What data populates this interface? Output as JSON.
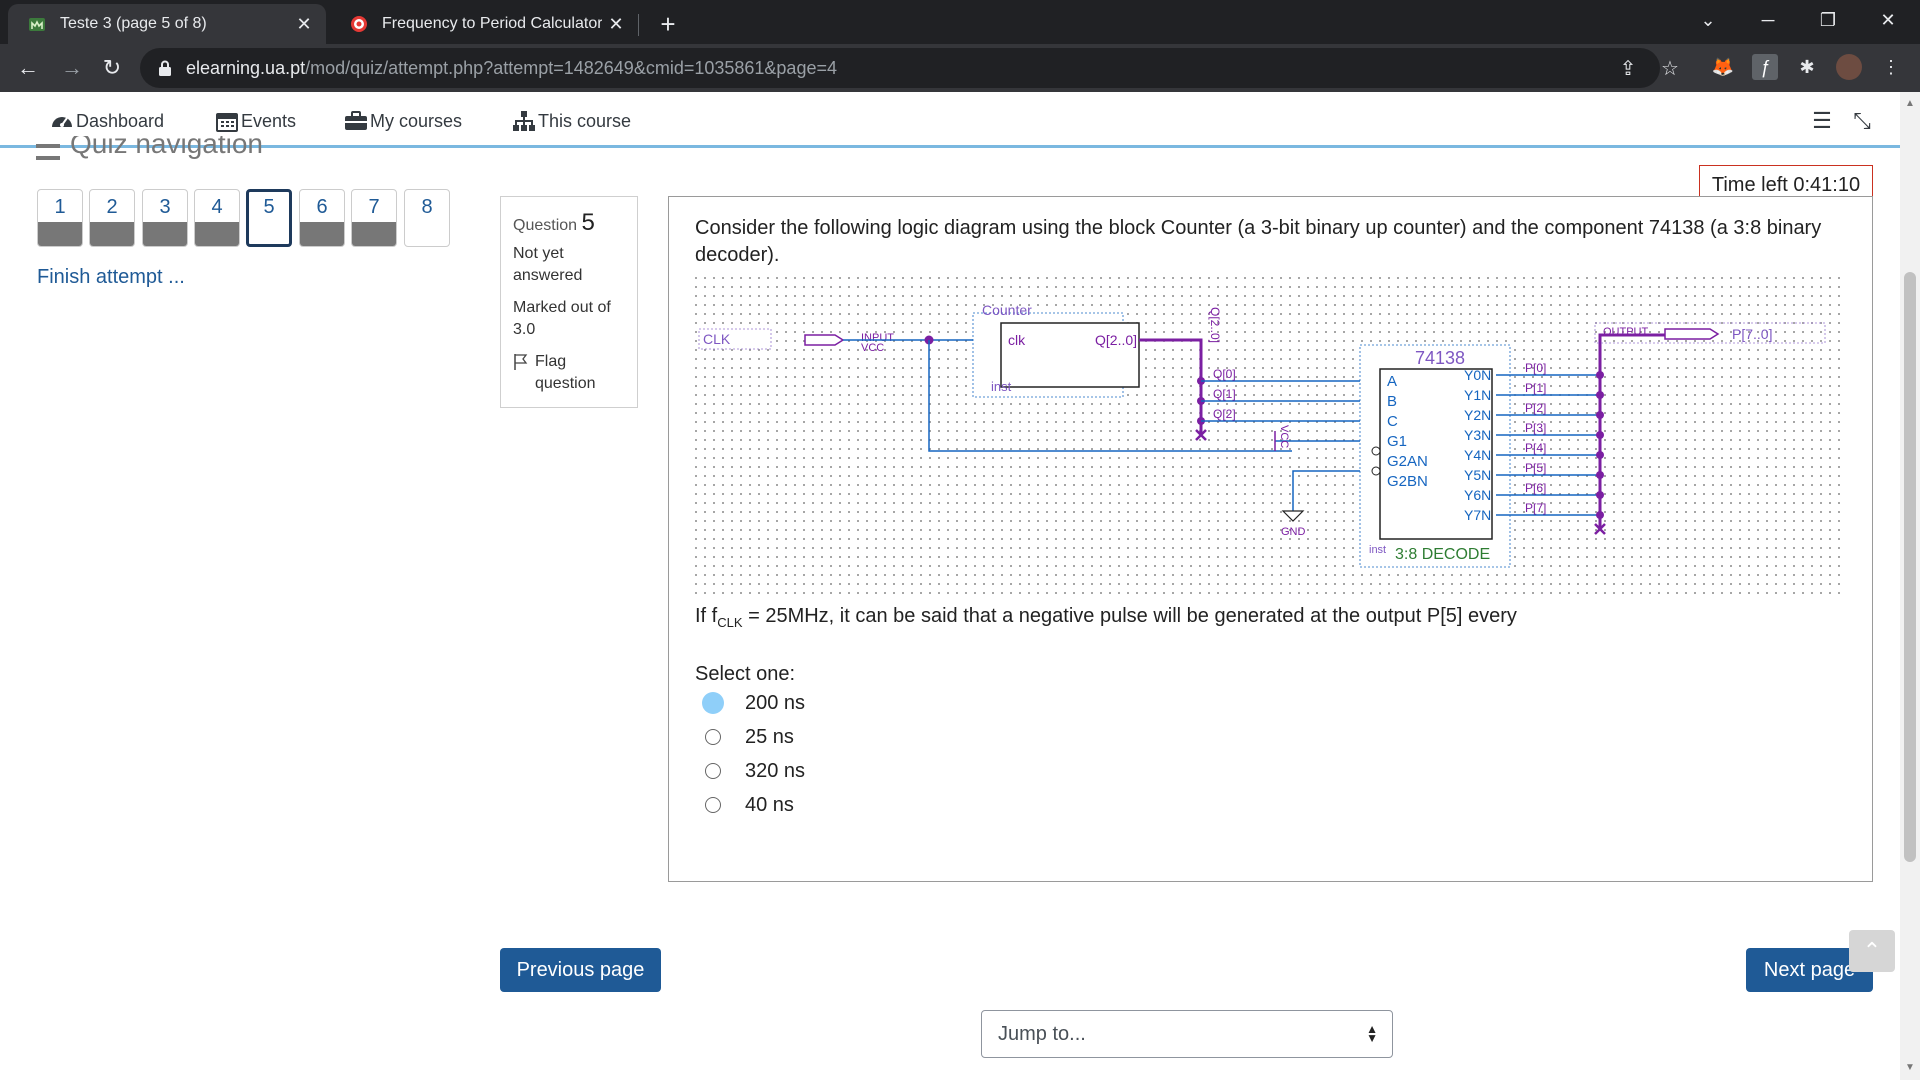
{
  "browser": {
    "tabs": [
      {
        "title": "Teste 3 (page 5 of 8)",
        "active": true
      },
      {
        "title": "Frequency to Period Calculator",
        "active": false
      }
    ],
    "url_host": "elearning.ua.pt",
    "url_path": "/mod/quiz/attempt.php?attempt=1482649&cmid=1035861&page=4"
  },
  "site_nav": {
    "items": [
      {
        "label": "Dashboard",
        "icon": "dashboard-icon"
      },
      {
        "label": "Events",
        "icon": "calendar-icon"
      },
      {
        "label": "My courses",
        "icon": "briefcase-icon"
      },
      {
        "label": "This course",
        "icon": "sitemap-icon"
      }
    ]
  },
  "quiz_nav": {
    "title": "Quiz navigation",
    "questions": [
      {
        "label": "1",
        "status": "answered"
      },
      {
        "label": "2",
        "status": "answered"
      },
      {
        "label": "3",
        "status": "answered"
      },
      {
        "label": "4",
        "status": "answered"
      },
      {
        "label": "5",
        "status": "current"
      },
      {
        "label": "6",
        "status": "answered"
      },
      {
        "label": "7",
        "status": "answered"
      },
      {
        "label": "8",
        "status": "notyet"
      }
    ],
    "finish_label": "Finish attempt ..."
  },
  "question_info": {
    "prefix": "Question",
    "number": "5",
    "state_line1": "Not yet",
    "state_line2": "answered",
    "marks_line1": "Marked out of",
    "marks_line2": "3.0",
    "flag_line1": "Flag",
    "flag_line2": "question"
  },
  "timer": "Time left 0:41:10",
  "question": {
    "text": "Consider the following logic diagram using the block Counter (a 3-bit binary up counter) and the component 74138 (a 3:8 binary decoder).",
    "prompt_before": "If f",
    "prompt_sub": "CLK",
    "prompt_after": " = 25MHz, it can be said that a negative pulse will be generated at the output P[5] every",
    "select_one": "Select one:",
    "options": [
      {
        "label": "200 ns",
        "selected": true
      },
      {
        "label": "25 ns",
        "selected": false
      },
      {
        "label": "320 ns",
        "selected": false
      },
      {
        "label": "40 ns",
        "selected": false
      }
    ]
  },
  "diagram": {
    "clk": "CLK",
    "input_label": "INPUT",
    "vcc": "VCC",
    "counter_title": "Counter",
    "counter_clk": "clk",
    "counter_out": "Q[2..0]",
    "bus_label": "Q[2..0]",
    "inst": "inst",
    "q0": "Q[0]",
    "q1": "Q[1]",
    "q2": "Q[2]",
    "dec_title": "74138",
    "dec_inputs": [
      "A",
      "B",
      "C",
      "G1",
      "G2AN",
      "G2BN"
    ],
    "dec_outputs": [
      "Y0N",
      "Y1N",
      "Y2N",
      "Y3N",
      "Y4N",
      "Y5N",
      "Y6N",
      "Y7N"
    ],
    "p_labels": [
      "P[0]",
      "P[1]",
      "P[2]",
      "P[3]",
      "P[4]",
      "P[5]",
      "P[6]",
      "P[7]"
    ],
    "dec_caption": "3:8 DECODE",
    "gnd": "GND",
    "output_label": "OUTPUT",
    "output_bus": "P[7..0]",
    "g1_vcc": "VCC"
  },
  "buttons": {
    "previous": "Previous page",
    "next": "Next page",
    "jump": "Jump to..."
  },
  "colors": {
    "primary": "#1f5a96",
    "wire_purple": "#7b1fa2",
    "wire_blue": "#1565c0",
    "selected_radio": "#8fcff9"
  }
}
